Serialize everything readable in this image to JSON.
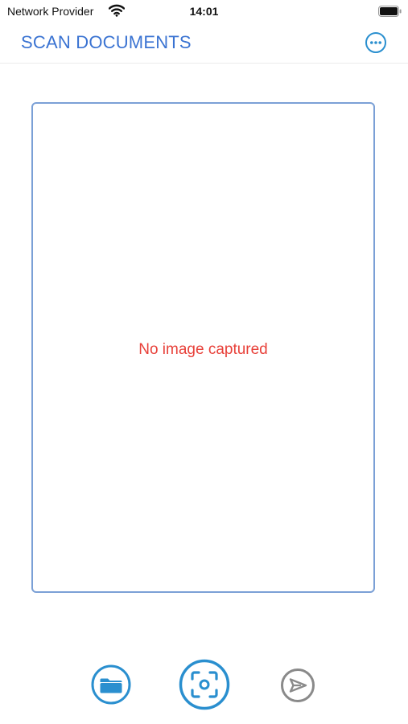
{
  "status_bar": {
    "carrier": "Network Provider",
    "time": "14:01",
    "icons": [
      "wifi-icon",
      "battery-icon"
    ]
  },
  "header": {
    "title": "SCAN DOCUMENTS",
    "menu_icon": "ellipsis-circle-icon"
  },
  "preview": {
    "empty_message": "No image captured"
  },
  "toolbar": {
    "buttons": [
      {
        "icon": "folder-icon",
        "enabled": true
      },
      {
        "icon": "scan-camera-icon",
        "enabled": true
      },
      {
        "icon": "send-icon",
        "enabled": false
      }
    ]
  },
  "colors": {
    "accent": "#3a73d2",
    "toolbar_accent": "#2a8fcf",
    "frame_border": "#7ba0d6",
    "empty_message": "#e8413a",
    "disabled": "#8a8a8a"
  }
}
